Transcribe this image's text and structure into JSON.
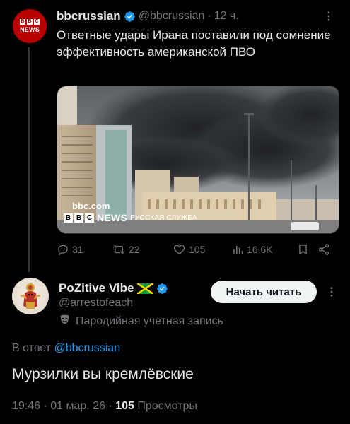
{
  "quoted_tweet": {
    "avatar_text": "NEWS",
    "avatar_blocks": [
      "B",
      "B",
      "C"
    ],
    "author_name": "bbcrussian",
    "author_handle": "@bbcrussian",
    "separator": "·",
    "time": "12 ч.",
    "text": "Ответные удары Ирана поставили под сомнение эффективность американской ПВО",
    "media": {
      "watermark_url": "bbc.com",
      "watermark_blocks": [
        "B",
        "B",
        "C"
      ],
      "watermark_brand": "NEWS",
      "watermark_service": "РУССКАЯ СЛУЖБА"
    },
    "stats": {
      "replies": "31",
      "reposts": "22",
      "likes": "105",
      "views": "16,6K"
    }
  },
  "reply_tweet": {
    "author_name": "PoZitive Vibe",
    "author_handle": "@arrestofeach",
    "parody_label": "Пародийная учетная запись",
    "follow_label": "Начать читать",
    "reply_to_prefix": "В ответ",
    "reply_to_mention": "@bbcrussian",
    "text": "Мурзилки вы кремлёвские",
    "timestamp": "19:46 · 01 мар. 26 ·",
    "views_count": "105",
    "views_label": "Просмотры"
  },
  "colors": {
    "background": "#000000",
    "text_primary": "#e7e9ea",
    "text_secondary": "#71767b",
    "accent": "#1d9bf0",
    "bbc_red": "#b80000"
  },
  "icons": [
    "verified-badge-icon",
    "more-icon",
    "reply-icon",
    "repost-icon",
    "like-icon",
    "views-icon",
    "bookmark-icon",
    "share-icon",
    "parody-mask-icon",
    "jamaica-flag-icon"
  ]
}
